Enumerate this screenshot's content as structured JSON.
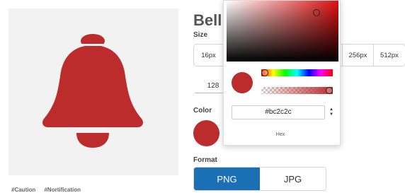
{
  "icon": {
    "name": "Bell",
    "glyph": "bell-icon",
    "tags": [
      "#Caution",
      "#Nortification"
    ]
  },
  "size": {
    "label": "Size",
    "options": [
      "16px",
      "256px",
      "512px"
    ],
    "custom_value": "128"
  },
  "color": {
    "label": "Color",
    "value": "#bc2c2c"
  },
  "picker": {
    "hex_value": "#bc2c2c",
    "mode_label": "Hex",
    "hue_color": "#e01010",
    "hue_fraction": 0.0,
    "alpha_fraction": 1.0
  },
  "format": {
    "label": "Format",
    "options": [
      "PNG",
      "JPG"
    ],
    "selected": "PNG",
    "accent": "#1a6fb5"
  }
}
